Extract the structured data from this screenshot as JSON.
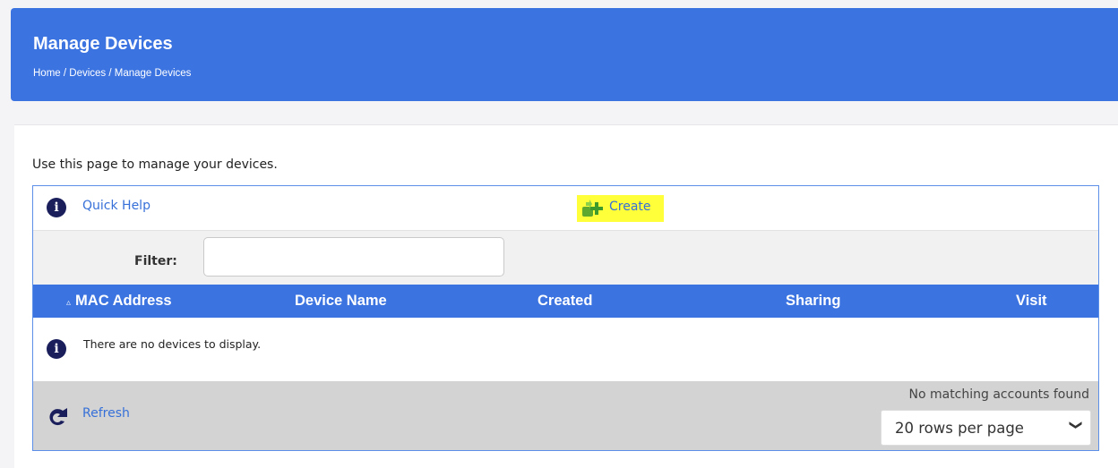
{
  "header": {
    "title": "Manage Devices",
    "breadcrumb": "Home / Devices / Manage Devices"
  },
  "intro_text": "Use this page to manage your devices.",
  "toolbar": {
    "quick_help_label": "Quick Help",
    "create_label": "Create",
    "info_glyph": "i"
  },
  "filter": {
    "label": "Filter:",
    "value": ""
  },
  "table": {
    "sort_indicator": "▵",
    "columns": [
      "MAC Address",
      "Device Name",
      "Created",
      "Sharing",
      "Visit"
    ],
    "empty_message": "There are no devices to display."
  },
  "footer": {
    "refresh_label": "Refresh",
    "match_status": "No matching accounts found",
    "rows_per_page": "20 rows per page",
    "chevron_glyph": "❯"
  },
  "colors": {
    "primary": "#3b73e1",
    "link": "#3670d8",
    "highlight": "#ffff3a",
    "footer_bg": "#d3d3d3"
  }
}
